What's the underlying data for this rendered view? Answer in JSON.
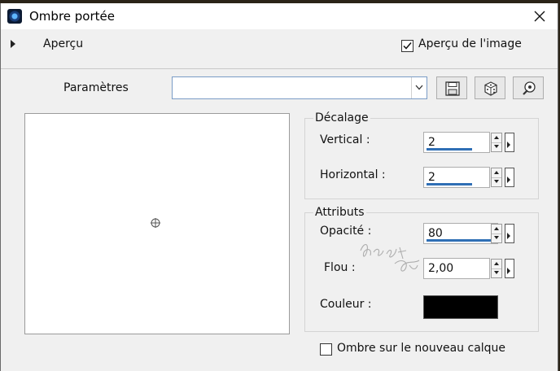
{
  "window": {
    "title": "Ombre portée",
    "close_icon": "close-icon"
  },
  "preview": {
    "toggle_label": "Aperçu",
    "image_preview_label": "Aperçu de l'image",
    "image_preview_checked": true
  },
  "presets": {
    "label": "Paramètres",
    "value": "",
    "buttons": [
      "save-icon",
      "random-dice-icon",
      "reset-settings-icon"
    ]
  },
  "offset": {
    "title": "Décalage",
    "vertical_label": "Vertical :",
    "vertical_value": "2",
    "horizontal_label": "Horizontal :",
    "horizontal_value": "2"
  },
  "attributes": {
    "title": "Attributs",
    "opacity_label": "Opacité :",
    "opacity_value": "80",
    "blur_label": "Flou :",
    "blur_value": "2,00",
    "color_label": "Couleur :",
    "color_value": "#000000"
  },
  "new_layer": {
    "label": "Ombre sur le nouveau calque",
    "checked": false
  },
  "colors": {
    "accent": "#2f6fb5",
    "dialog_bg": "#f0f0f0"
  }
}
